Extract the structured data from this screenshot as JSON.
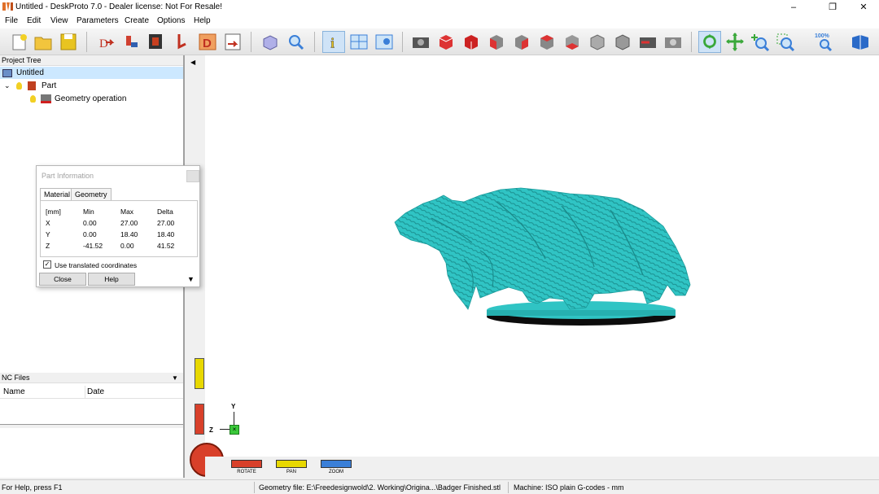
{
  "window": {
    "title": "Untitled - DeskProto 7.0 - Dealer license: Not For Resale!",
    "controls": [
      "–",
      "❐",
      "✕"
    ]
  },
  "menu": [
    "File",
    "Edit",
    "View",
    "Parameters",
    "Create",
    "Options",
    "Help"
  ],
  "toolbar": {
    "zoom_label": "100%",
    "icons": [
      "new-icon",
      "open-icon",
      "save-icon",
      "import-icon",
      "part-icon",
      "machine-icon",
      "cutter-icon",
      "drawing-icon",
      "save-image-icon",
      "cube-icon",
      "zoom-icon",
      "info-icon",
      "layout-icon",
      "split-icon",
      "camera-icon",
      "view-front-icon",
      "view-back-icon",
      "view-left-icon",
      "view-right-icon",
      "view-top-icon",
      "view-bottom-icon",
      "view-iso-icon",
      "view-iso2-icon",
      "render-icon",
      "render2-icon",
      "rotate-mode-icon",
      "pan-mode-icon",
      "zoom-mode-icon",
      "zoom-box-icon",
      "zoom-100-icon",
      "help-book-icon"
    ]
  },
  "project_tree": {
    "header": "Project Tree",
    "root": "Untitled",
    "part": "Part",
    "operation": "Geometry operation"
  },
  "nc_files": {
    "header": "NC Files",
    "columns": [
      "Name",
      "Date"
    ]
  },
  "part_info": {
    "title": "Part Information",
    "tabs": [
      "Material",
      "Geometry"
    ],
    "columns": [
      "[mm]",
      "Min",
      "Max",
      "Delta"
    ],
    "rows": [
      {
        "axis": "X",
        "min": "0.00",
        "max": "27.00",
        "delta": "27.00"
      },
      {
        "axis": "Y",
        "min": "0.00",
        "max": "18.40",
        "delta": "18.40"
      },
      {
        "axis": "Z",
        "min": "-41.52",
        "max": "0.00",
        "delta": "41.52"
      }
    ],
    "checkbox_label": "Use translated coordinates",
    "checkbox_checked": true,
    "close_label": "Close",
    "help_label": "Help"
  },
  "axes": {
    "y": "Y",
    "z": "Z"
  },
  "nav": [
    {
      "label": "ROTATE",
      "color": "#d8402a"
    },
    {
      "label": "PAN",
      "color": "#e8d800"
    },
    {
      "label": "ZOOM",
      "color": "#3a7fd8"
    }
  ],
  "model": {
    "color": "#30c4c4"
  },
  "status": {
    "help": "For Help, press F1",
    "geometry": "Geometry file: E:\\Freedesignwold\\2. Working\\Origina...\\Badger Finished.stl",
    "machine": "Machine: ISO plain G-codes - mm"
  }
}
